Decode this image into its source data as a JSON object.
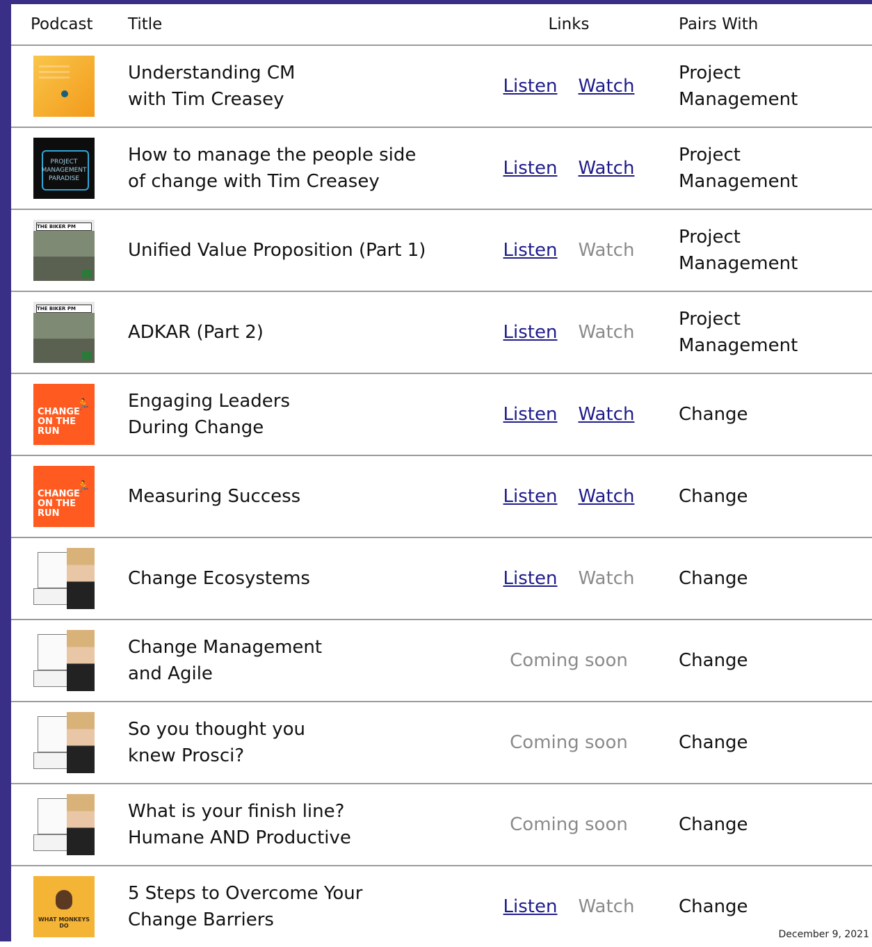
{
  "header": {
    "podcast": "Podcast",
    "title": "Title",
    "links": "Links",
    "pairs": "Pairs With"
  },
  "rows": [
    {
      "thumb": "project-management-office-hours",
      "title_lines": [
        "Understanding CM",
        "with Tim Creasey"
      ],
      "listen": "Listen",
      "watch": "Watch",
      "listen_active": true,
      "watch_active": true,
      "pairs_lines": [
        "Project",
        "Management"
      ]
    },
    {
      "thumb": "project-management-paradise",
      "title_lines": [
        "How to manage the people side",
        "of change with Tim Creasey"
      ],
      "listen": "Listen",
      "watch": "Watch",
      "listen_active": true,
      "watch_active": true,
      "pairs_lines": [
        "Project",
        "Management"
      ]
    },
    {
      "thumb": "the-biker-pm",
      "title_lines": [
        "Unified Value Proposition (Part 1)"
      ],
      "listen": "Listen",
      "watch": "Watch",
      "listen_active": true,
      "watch_active": false,
      "pairs_lines": [
        "Project",
        "Management"
      ]
    },
    {
      "thumb": "the-biker-pm",
      "title_lines": [
        "ADKAR (Part 2)"
      ],
      "listen": "Listen",
      "watch": "Watch",
      "listen_active": true,
      "watch_active": false,
      "pairs_lines": [
        "Project",
        "Management"
      ]
    },
    {
      "thumb": "change-on-the-run",
      "title_lines": [
        "Engaging Leaders",
        "During Change"
      ],
      "listen": "Listen",
      "watch": "Watch",
      "listen_active": true,
      "watch_active": true,
      "pairs_lines": [
        "Change"
      ]
    },
    {
      "thumb": "change-on-the-run",
      "title_lines": [
        "Measuring Success"
      ],
      "listen": "Listen",
      "watch": "Watch",
      "listen_active": true,
      "watch_active": true,
      "pairs_lines": [
        "Change"
      ]
    },
    {
      "thumb": "change-podcast-host",
      "title_lines": [
        "Change Ecosystems"
      ],
      "listen": "Listen",
      "watch": "Watch",
      "listen_active": true,
      "watch_active": false,
      "pairs_lines": [
        "Change"
      ]
    },
    {
      "thumb": "change-podcast-host",
      "title_lines": [
        "Change Management",
        "and Agile"
      ],
      "coming_soon": "Coming soon",
      "pairs_lines": [
        "Change"
      ]
    },
    {
      "thumb": "change-podcast-host",
      "title_lines": [
        "So you thought you",
        "knew Prosci?"
      ],
      "coming_soon": "Coming soon",
      "pairs_lines": [
        "Change"
      ]
    },
    {
      "thumb": "change-podcast-host",
      "title_lines": [
        "What is your finish line?",
        "Humane AND Productive"
      ],
      "coming_soon": "Coming soon",
      "pairs_lines": [
        "Change"
      ]
    },
    {
      "thumb": "what-monkeys-do",
      "title_lines": [
        "5 Steps to Overcome Your",
        "Change Barriers"
      ],
      "listen": "Listen",
      "watch": "Watch",
      "listen_active": true,
      "watch_active": false,
      "pairs_lines": [
        "Change"
      ]
    }
  ],
  "thumb_text": {
    "pmp": [
      "PROJECT",
      "MANAGEMENT",
      "PARADISE"
    ],
    "cotr": [
      "CHANGE",
      "ON THE RUN"
    ],
    "biker": "THE BIKER PM",
    "wmd": "WHAT MONKEYS DO"
  },
  "footer": {
    "date": "December 9, 2021"
  },
  "colors": {
    "frame": "#3a2f86",
    "link": "#1e1b8a",
    "disabled": "#8a8a8a",
    "divider": "#9a9a9a"
  }
}
